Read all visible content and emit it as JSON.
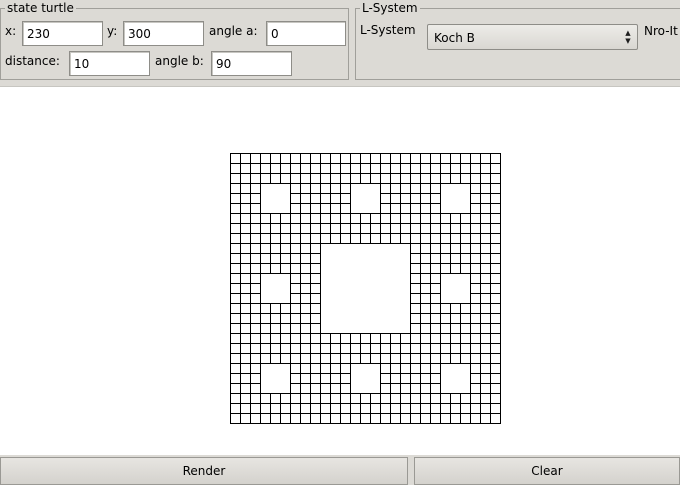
{
  "state_turtle": {
    "title": "state turtle",
    "x_label": "x:",
    "x_value": "230",
    "y_label": "y:",
    "y_value": "300",
    "angle_a_label": "angle a:",
    "angle_a_value": "0",
    "distance_label": "distance:",
    "distance_value": "10",
    "angle_b_label": "angle b:",
    "angle_b_value": "90"
  },
  "lsystem": {
    "title": "L-System",
    "label": "L-System",
    "selected": "Koch B",
    "iterations_label": "Nro-It"
  },
  "canvas": {
    "figure": "quadratic-koch-island-fractal",
    "stroke_color": "#000000",
    "levels": 3
  },
  "buttons": {
    "render": "Render",
    "clear": "Clear"
  },
  "colors": {
    "panel_bg": "#dcdad5",
    "canvas_bg": "#ffffff"
  }
}
